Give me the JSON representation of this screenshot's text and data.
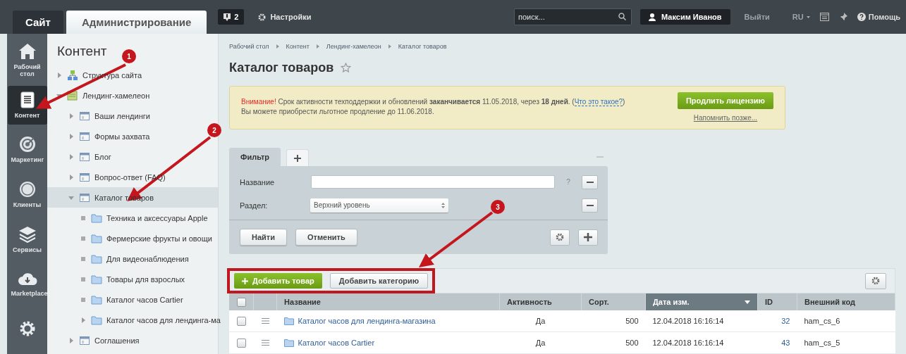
{
  "top_bar": {
    "tabs": [
      {
        "label": "Сайт",
        "selected": false
      },
      {
        "label": "Администрирование",
        "selected": true
      }
    ],
    "notifications_count": "2",
    "settings_label": "Настройки",
    "search": {
      "placeholder": "поиск..."
    },
    "user_name": "Максим Иванов",
    "logout": "Выйти",
    "language": "RU",
    "help": "Помощь"
  },
  "nav": [
    {
      "kind": "home",
      "label": "Рабочий стол",
      "selected": false
    },
    {
      "kind": "content",
      "label": "Контент",
      "selected": true
    },
    {
      "kind": "marketing",
      "label": "Маркетинг",
      "selected": false
    },
    {
      "kind": "clients",
      "label": "Клиенты",
      "selected": false
    },
    {
      "kind": "services",
      "label": "Сервисы",
      "selected": false
    },
    {
      "kind": "marketplace",
      "label": "Marketplace",
      "selected": false
    },
    {
      "kind": "settings",
      "selected": false
    }
  ],
  "tree": {
    "title": "Контент",
    "items": [
      {
        "label": "Структура сайта",
        "kind": "structure",
        "expanded": false,
        "selected": false
      },
      {
        "label": "Лендинг-хамелеон",
        "kind": "site",
        "expanded": true,
        "selected": false,
        "children": [
          {
            "label": "Ваши лендинги",
            "kind": "section",
            "expanded": false,
            "selected": false
          },
          {
            "label": "Формы захвата",
            "kind": "section",
            "expanded": false,
            "selected": false
          },
          {
            "label": "Блог",
            "kind": "section",
            "expanded": false,
            "selected": false
          },
          {
            "label": "Вопрос-ответ (FAQ)",
            "kind": "section",
            "expanded": false,
            "selected": false
          },
          {
            "label": "Каталог товаров",
            "kind": "section",
            "expanded": true,
            "selected": true,
            "children": [
              {
                "label": "Техника и аксессуары Apple",
                "kind": "folder",
                "selected": false
              },
              {
                "label": "Фермерские фрукты и овощи",
                "kind": "folder",
                "selected": false
              },
              {
                "label": "Для видеонаблюдения",
                "kind": "folder",
                "selected": false
              },
              {
                "label": "Товары для взрослых",
                "kind": "folder",
                "selected": false
              },
              {
                "label": "Каталог часов Cartier",
                "kind": "folder",
                "selected": false
              },
              {
                "label": "Каталог часов для лендинга-ма",
                "kind": "folder",
                "expanded": false,
                "selected": false
              }
            ]
          },
          {
            "label": "Соглашения",
            "kind": "section",
            "expanded": false,
            "selected": false
          }
        ]
      }
    ]
  },
  "breadcrumbs": [
    "Рабочий стол",
    "Контент",
    "Лендинг-хамелеон",
    "Каталог товаров"
  ],
  "page_title": "Каталог товаров",
  "notice": {
    "warning": "Внимание!",
    "text": "Срок активности техподдержки и обновлений **заканчивается** 11.05.2018, через **18 дней**. (",
    "link": "Что это такое?",
    "text_end": ")",
    "line2": "Вы можете приобрести льготное продление до 11.06.2018.",
    "button": "Продлить лицензию",
    "remind": "Напомнить позже..."
  },
  "filter": {
    "tabs": [
      {
        "label": "Фильтр",
        "selected": true
      }
    ],
    "fields": [
      {
        "kind": "text",
        "label": "Название",
        "help": "?"
      },
      {
        "kind": "select",
        "label": "Раздел:",
        "value": "Верхний уровень"
      }
    ],
    "buttons": [
      "Найти",
      "Отменить"
    ]
  },
  "grid": {
    "buttons": [
      {
        "kind": "primary",
        "label": "Добавить товар"
      },
      {
        "kind": "default",
        "label": "Добавить категорию"
      }
    ],
    "all_checked": false,
    "columns": [
      {
        "label": "Название",
        "sorted": false
      },
      {
        "label": "Активность",
        "sorted": false
      },
      {
        "label": "Сорт.",
        "sorted": false
      },
      {
        "label": "Дата изм.",
        "sorted": true
      },
      {
        "label": "ID",
        "sorted": false
      },
      {
        "label": "Внешний код",
        "sorted": false
      }
    ],
    "rows": [
      {
        "checked": false,
        "name": "Каталог часов для лендинга-магазина",
        "active": "Да",
        "sort": "500",
        "date": "12.04.2018 16:16:14",
        "id": "32",
        "code": "ham_cs_6"
      },
      {
        "checked": false,
        "name": "Каталог часов Cartier",
        "active": "Да",
        "sort": "500",
        "date": "12.04.2018 16:16:14",
        "id": "43",
        "code": "ham_cs_5"
      }
    ]
  },
  "annotations": [
    {
      "number": "1"
    },
    {
      "number": "2"
    },
    {
      "number": "3"
    }
  ]
}
